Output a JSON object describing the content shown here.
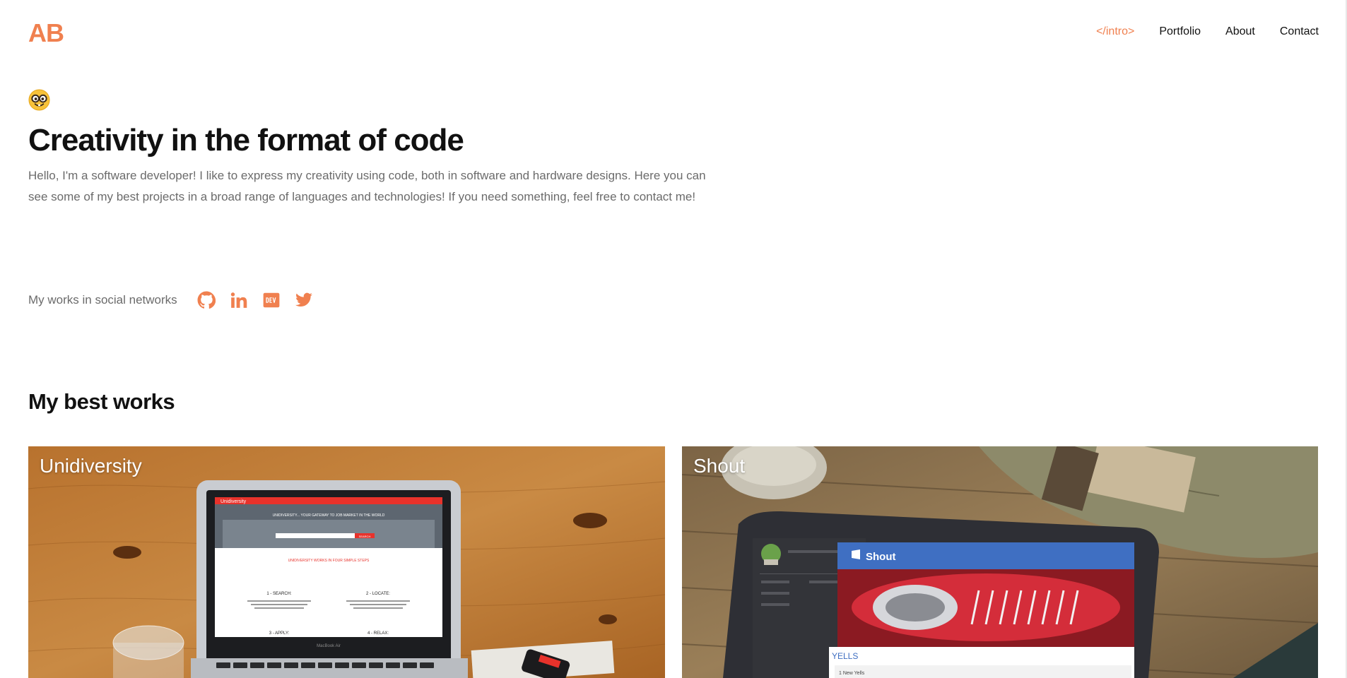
{
  "header": {
    "logo": "AB",
    "nav": [
      {
        "label": "</intro>",
        "active": true
      },
      {
        "label": "Portfolio",
        "active": false
      },
      {
        "label": "About",
        "active": false
      },
      {
        "label": "Contact",
        "active": false
      }
    ]
  },
  "hero": {
    "emoji_icon": "nerd-face-emoji",
    "title": "Creativity in the format of code",
    "description": "Hello, I'm a software developer! I like to express my creativity using code, both in software and hardware designs. Here you can see some of my best projects in a broad range of languages and technologies! If you need something, feel free to contact me!"
  },
  "social": {
    "label": "My works in social networks",
    "icons": [
      "github-icon",
      "linkedin-icon",
      "dev-icon",
      "twitter-icon"
    ]
  },
  "works": {
    "title": "My best works",
    "items": [
      {
        "title": "Unidiversity",
        "screen": {
          "brand": "Unidiversity",
          "tagline": "UNIDIVERSITY... YOUR GATEWAY TO JOB MARKET IN THE WORLD",
          "button": "SEARCH",
          "subheading": "UNIDIVERSITY WORKS IN FOUR SIMPLE STEPS",
          "steps": [
            "1 - SEARCH:",
            "2 - LOCATE:",
            "3 - APPLY:",
            "4 - RELAX:"
          ],
          "laptop": "MacBook Air"
        }
      },
      {
        "title": "Shout",
        "screen": {
          "app": "Shout",
          "section": "YELLS",
          "item": "1 New Yells"
        }
      }
    ]
  },
  "colors": {
    "accent": "#f0804f",
    "text": "#111111",
    "muted": "#6b6b6b"
  }
}
